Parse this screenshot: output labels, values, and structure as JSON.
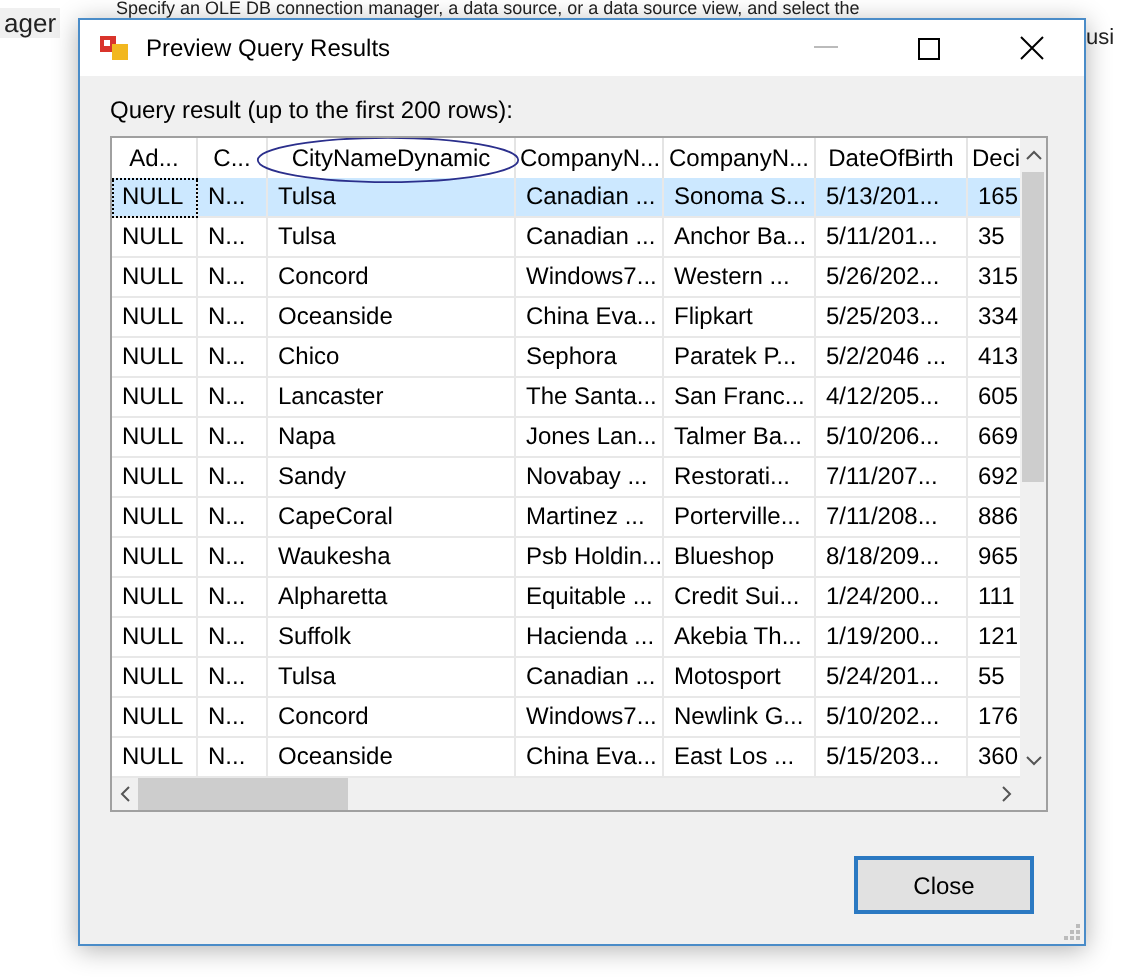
{
  "background": {
    "left_text": "ager",
    "top_text": "Specify an OLE DB connection manager, a data source, or a data source view, and select the",
    "right_text": "usi"
  },
  "window": {
    "title": "Preview Query Results"
  },
  "caption": "Query result (up to the first 200 rows):",
  "table": {
    "columns": [
      "Ad...",
      "C...",
      "CityNameDynamic",
      "CompanyN...",
      "CompanyN...",
      "DateOfBirth",
      "Deci"
    ],
    "rows": [
      {
        "selected": true,
        "cells": [
          "NULL",
          "N...",
          "Tulsa",
          "Canadian ...",
          "Sonoma S...",
          "5/13/201...",
          "165"
        ]
      },
      {
        "selected": false,
        "cells": [
          "NULL",
          "N...",
          "Tulsa",
          "Canadian ...",
          "Anchor Ba...",
          "5/11/201...",
          "35"
        ]
      },
      {
        "selected": false,
        "cells": [
          "NULL",
          "N...",
          "Concord",
          "Windows7...",
          "Western ...",
          "5/26/202...",
          "315"
        ]
      },
      {
        "selected": false,
        "cells": [
          "NULL",
          "N...",
          "Oceanside",
          "China Eva...",
          "Flipkart",
          "5/25/203...",
          "334"
        ]
      },
      {
        "selected": false,
        "cells": [
          "NULL",
          "N...",
          "Chico",
          "Sephora",
          "Paratek P...",
          "5/2/2046 ...",
          "413"
        ]
      },
      {
        "selected": false,
        "cells": [
          "NULL",
          "N...",
          "Lancaster",
          "The Santa...",
          "San Franc...",
          "4/12/205...",
          "605"
        ]
      },
      {
        "selected": false,
        "cells": [
          "NULL",
          "N...",
          "Napa",
          "Jones Lan...",
          "Talmer Ba...",
          "5/10/206...",
          "669"
        ]
      },
      {
        "selected": false,
        "cells": [
          "NULL",
          "N...",
          "Sandy",
          "Novabay ...",
          "Restorati...",
          "7/11/207...",
          "692"
        ]
      },
      {
        "selected": false,
        "cells": [
          "NULL",
          "N...",
          "CapeCoral",
          "Martinez ...",
          "Porterville...",
          "7/11/208...",
          "886"
        ]
      },
      {
        "selected": false,
        "cells": [
          "NULL",
          "N...",
          "Waukesha",
          "Psb Holdin...",
          "Blueshop",
          "8/18/209...",
          "965"
        ]
      },
      {
        "selected": false,
        "cells": [
          "NULL",
          "N...",
          "Alpharetta",
          "Equitable ...",
          "Credit Sui...",
          "1/24/200...",
          "111"
        ]
      },
      {
        "selected": false,
        "cells": [
          "NULL",
          "N...",
          "Suffolk",
          "Hacienda ...",
          "Akebia Th...",
          "1/19/200...",
          "121"
        ]
      },
      {
        "selected": false,
        "cells": [
          "NULL",
          "N...",
          "Tulsa",
          "Canadian ...",
          "Motosport",
          "5/24/201...",
          "55"
        ]
      },
      {
        "selected": false,
        "cells": [
          "NULL",
          "N...",
          "Concord",
          "Windows7...",
          "Newlink G...",
          "5/10/202...",
          "176"
        ]
      },
      {
        "selected": false,
        "cells": [
          "NULL",
          "N...",
          "Oceanside",
          "China Eva...",
          "East Los ...",
          "5/15/203...",
          "360"
        ]
      }
    ]
  },
  "buttons": [
    "Close"
  ]
}
